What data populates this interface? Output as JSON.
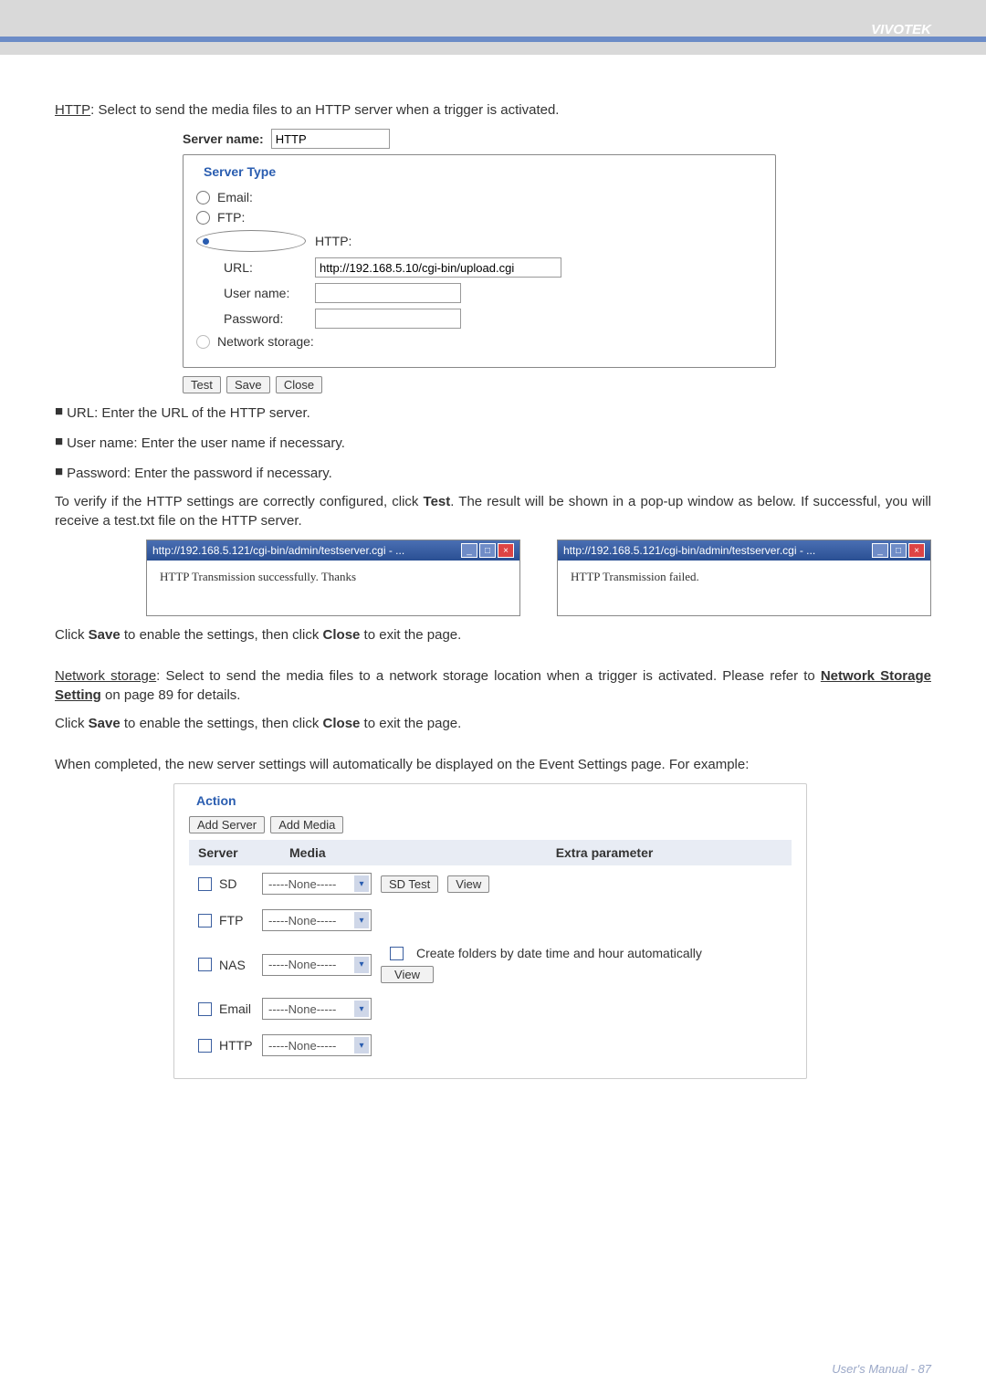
{
  "brand": "VIVOTEK",
  "http_intro_prefix": "HTTP",
  "http_intro_rest": ": Select to send the media files to an HTTP server when a trigger is activated.",
  "srv_name_lbl": "Server name:",
  "srv_name_val": "HTTP",
  "srv_type_legend": "Server Type",
  "radios": {
    "email": "Email:",
    "ftp": "FTP:",
    "http": "HTTP:",
    "netstorage": "Network storage:"
  },
  "http_fields": {
    "url_lbl": "URL:",
    "url_val": "http://192.168.5.10/cgi-bin/upload.cgi",
    "user_lbl": "User name:",
    "pass_lbl": "Password:"
  },
  "buttons": {
    "test": "Test",
    "save": "Save",
    "close": "Close"
  },
  "bullets": {
    "url": "URL: Enter the URL of the HTTP server.",
    "user": "User name: Enter the user name if necessary.",
    "pass": "Password: Enter the password if necessary."
  },
  "verify_para_a": "To verify if the HTTP settings are correctly configured, click ",
  "verify_para_b": ". The result will be shown in a pop-up window as below. If successful, you will receive a test.txt file on the HTTP server.",
  "popup_title": "http://192.168.5.121/cgi-bin/admin/testserver.cgi - ...",
  "popup_ok": "HTTP Transmission successfully. Thanks",
  "popup_fail": "HTTP Transmission failed.",
  "click_save_a": "Click ",
  "click_save_b": " to enable the settings, then click ",
  "click_save_c": " to exit the page.",
  "netstorage_prefix": "Network storage",
  "netstorage_rest_a": ": Select to send the media files to a network storage location when a trigger is activated. Please refer to ",
  "netstorage_link": "Network Storage Setting",
  "netstorage_rest_b": " on page 89 for details.",
  "completed_para": "When completed, the new server settings will automatically be displayed on the Event Settings page. For example:",
  "action": {
    "legend": "Action",
    "add_server": "Add Server",
    "add_media": "Add Media",
    "headers": {
      "server": "Server",
      "media": "Media",
      "extra": "Extra parameter"
    },
    "none_opt": "-----None-----",
    "rows": {
      "sd": "SD",
      "ftp": "FTP",
      "nas": "NAS",
      "email": "Email",
      "http": "HTTP"
    },
    "sd_test": "SD Test",
    "view": "View",
    "nas_extra": "Create folders by date time and hour automatically"
  },
  "footer": "User's Manual - 87"
}
